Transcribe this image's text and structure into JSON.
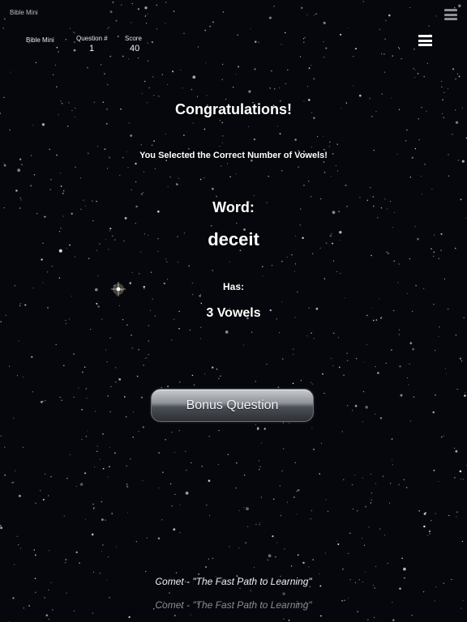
{
  "window": {
    "title": "Bible Mini"
  },
  "header": {
    "app_name": "Bible Mini",
    "question_label": "Question #",
    "question_value": "1",
    "score_label": "Score",
    "score_value": "40"
  },
  "icons": {
    "corner_menu": "stack-icon",
    "main_menu": "hamburger-menu-icon"
  },
  "result": {
    "title": "Congratulations!",
    "message": "You Selected the Correct Number of Vowels!",
    "word_label": "Word:",
    "word": "deceit",
    "has_label": "Has:",
    "vowel_count": "3 Vowels"
  },
  "actions": {
    "bonus_label": "Bonus Question"
  },
  "footer": {
    "tagline": "Comet - \"The Fast Path to Learning\"",
    "tagline_dimmed": "Comet - \"The Fast Path to Learning\""
  },
  "colors": {
    "background": "#05070c",
    "text": "#ffffff",
    "button_top": "#c7cacf",
    "button_bottom": "#2d3036",
    "footer_dimmed": "#8a8d93"
  }
}
